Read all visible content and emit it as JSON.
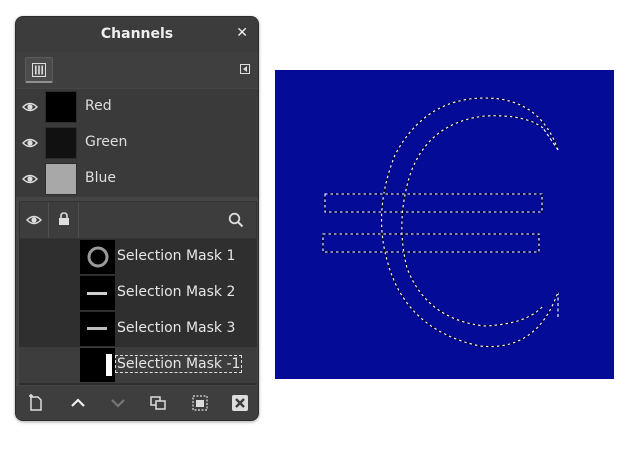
{
  "dialog": {
    "title": "Channels",
    "close_glyph": "✕"
  },
  "tabs": {
    "active_icon": "channels-tab-icon",
    "menu_icon": "tab-menu-icon"
  },
  "channels": [
    {
      "name": "Red",
      "thumb_color": "#000000"
    },
    {
      "name": "Green",
      "thumb_color": "#111111"
    },
    {
      "name": "Blue",
      "thumb_color": "#a8a8a8"
    }
  ],
  "mask_header": {
    "icons": [
      "eye-icon",
      "lock-icon",
      "search-icon"
    ]
  },
  "masks": [
    {
      "name": "Selection Mask 1",
      "thumb": "ring",
      "selected": false
    },
    {
      "name": "Selection Mask 2",
      "thumb": "bar",
      "selected": false
    },
    {
      "name": "Selection Mask 3",
      "thumb": "bar",
      "selected": false
    },
    {
      "name": "Selection Mask -1",
      "thumb": "strip",
      "selected": true,
      "editing": true
    }
  ],
  "bottom_toolbar": [
    "new-channel-icon",
    "raise-channel-icon",
    "lower-channel-icon",
    "duplicate-channel-icon",
    "channel-to-selection-icon",
    "delete-channel-icon"
  ],
  "canvas": {
    "background": "#040b96",
    "content": "euro-sign-selection-marching-ants"
  }
}
